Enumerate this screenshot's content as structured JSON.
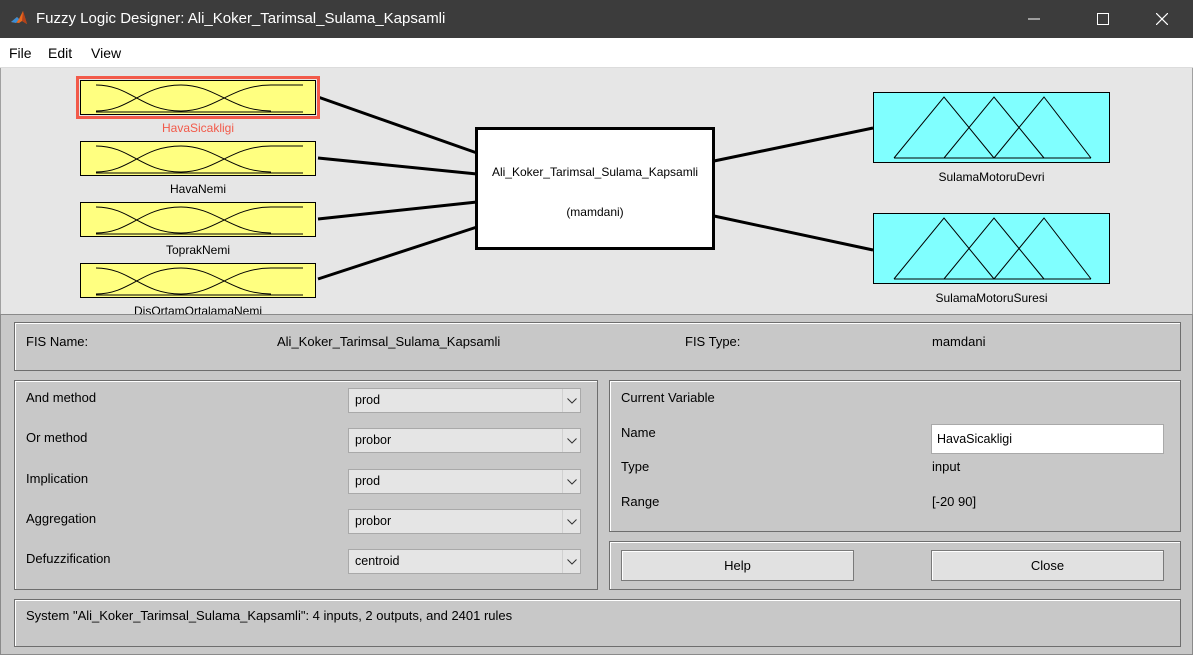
{
  "window": {
    "title": "Fuzzy Logic Designer: Ali_Koker_Tarimsal_Sulama_Kapsamli",
    "minimize_icon": "minimize-icon",
    "maximize_icon": "maximize-icon",
    "close_icon": "close-icon"
  },
  "menu": {
    "items": [
      "File",
      "Edit",
      "View"
    ]
  },
  "diagram": {
    "inputs": [
      {
        "name": "HavaSicakligi",
        "selected": true
      },
      {
        "name": "HavaNemi",
        "selected": false
      },
      {
        "name": "ToprakNemi",
        "selected": false
      },
      {
        "name": "DisOrtamOrtalamaNemi",
        "selected": false
      }
    ],
    "outputs": [
      {
        "name": "SulamaMotoruDevri"
      },
      {
        "name": "SulamaMotoruSuresi"
      }
    ],
    "fis_block": {
      "name": "Ali_Koker_Tarimsal_Sulama_Kapsamli",
      "kind": "(mamdani)"
    },
    "colors": {
      "input_fill": "#ffff80",
      "output_fill": "#80ffff",
      "selected": "#f25a4a"
    }
  },
  "info": {
    "fis_name_label": "FIS Name:",
    "fis_name_value": "Ali_Koker_Tarimsal_Sulama_Kapsamli",
    "fis_type_label": "FIS Type:",
    "fis_type_value": "mamdani"
  },
  "methods": {
    "and_label": "And method",
    "and_value": "prod",
    "or_label": "Or method",
    "or_value": "probor",
    "implication_label": "Implication",
    "implication_value": "prod",
    "aggregation_label": "Aggregation",
    "aggregation_value": "probor",
    "defuzz_label": "Defuzzification",
    "defuzz_value": "centroid"
  },
  "current_variable": {
    "heading": "Current Variable",
    "name_label": "Name",
    "name_value": "HavaSicakligi",
    "type_label": "Type",
    "type_value": "input",
    "range_label": "Range",
    "range_value": "[-20 90]"
  },
  "buttons": {
    "help": "Help",
    "close": "Close"
  },
  "status": "System \"Ali_Koker_Tarimsal_Sulama_Kapsamli\": 4 inputs, 2 outputs, and 2401 rules"
}
